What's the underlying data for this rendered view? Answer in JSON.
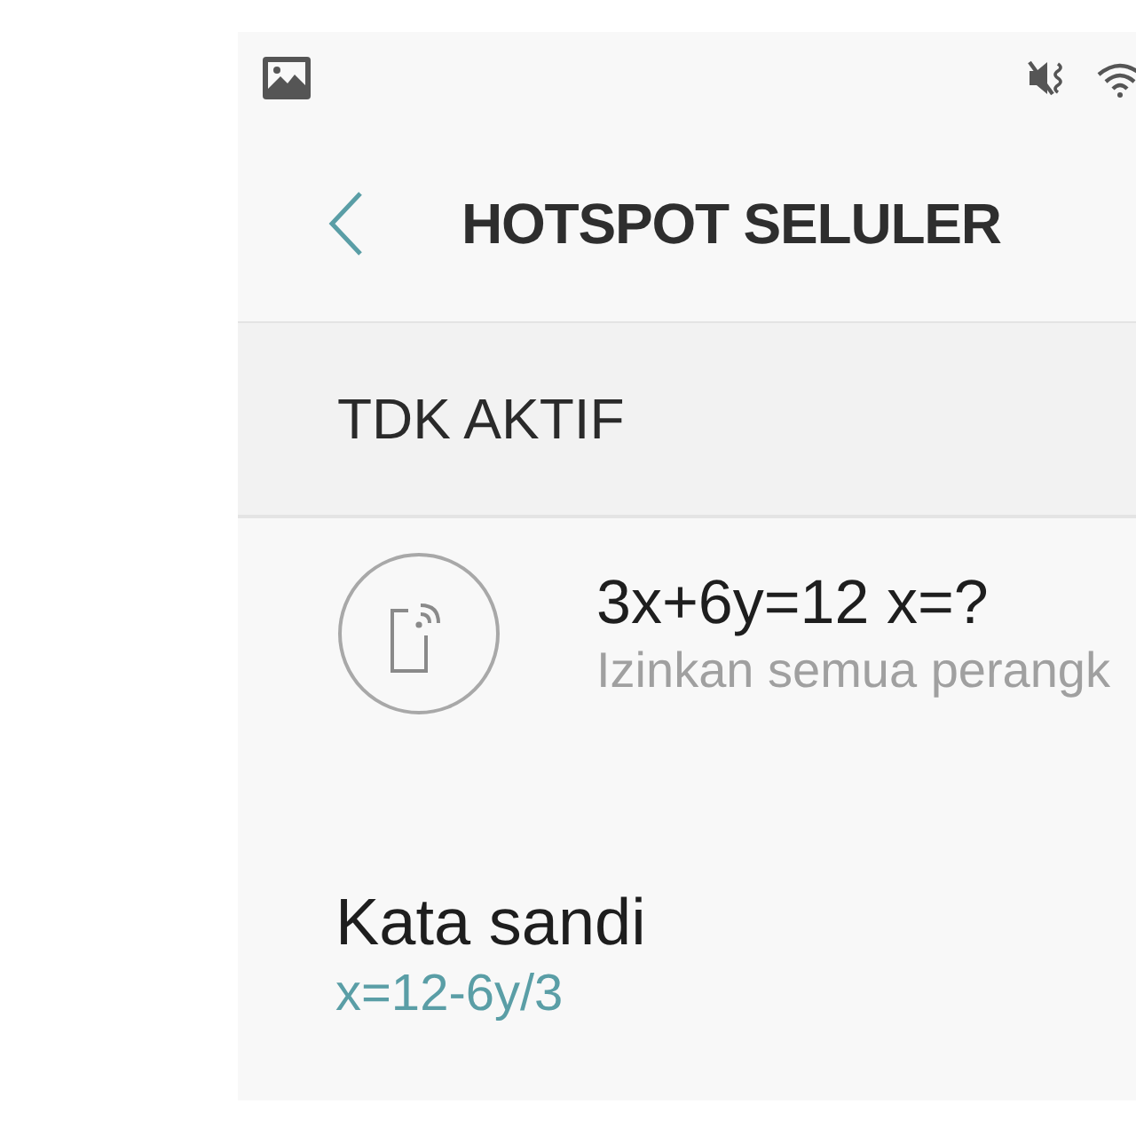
{
  "header": {
    "title": "HOTSPOT SELULER"
  },
  "master_switch": {
    "label": "TDK AKTIF"
  },
  "settings": [
    {
      "kind": "icon_row",
      "title": "3x+6y=12 x=?",
      "subtitle": "Izinkan semua perangk"
    },
    {
      "kind": "text_row",
      "title": "Kata sandi",
      "value": "x=12-6y/3"
    }
  ]
}
